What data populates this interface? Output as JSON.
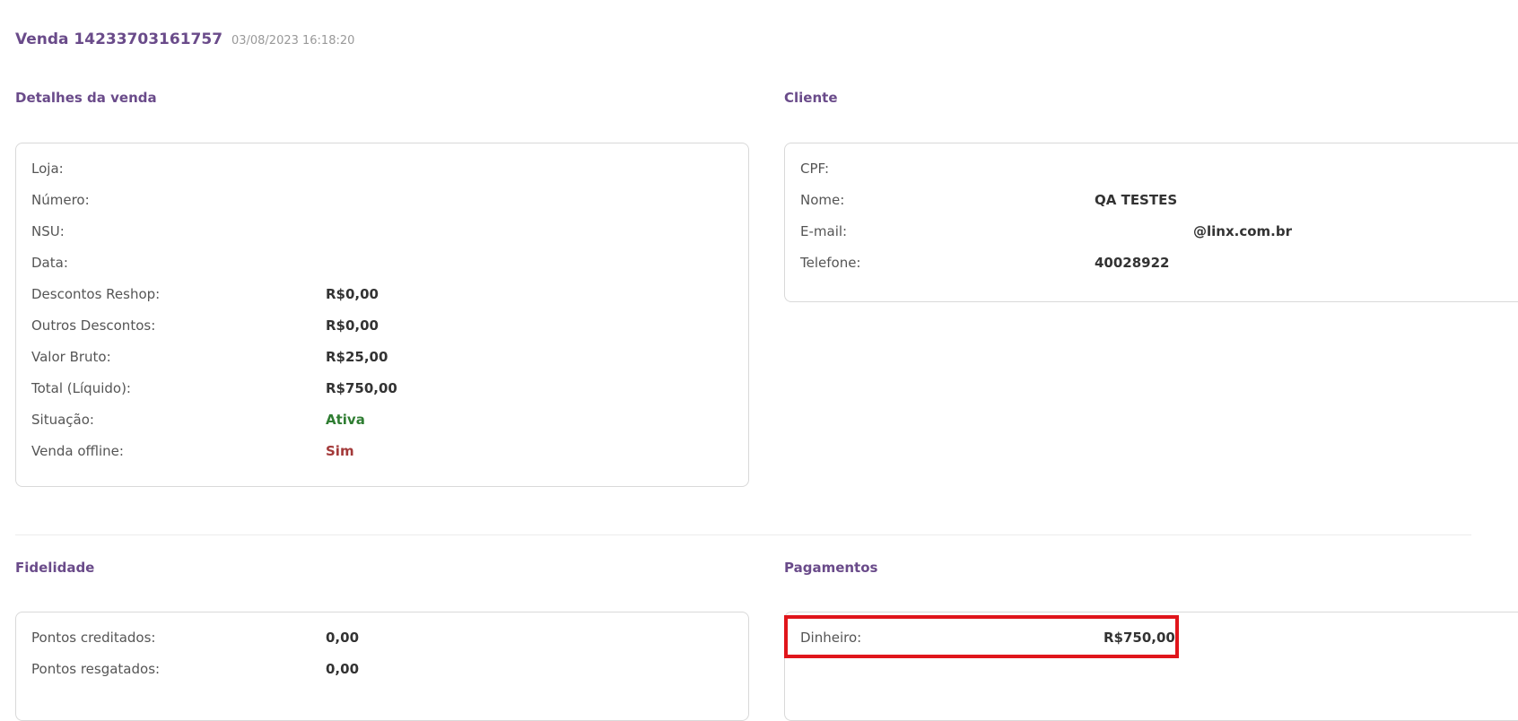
{
  "header": {
    "title": "Venda 14233703161757",
    "datetime": "03/08/2023 16:18:20"
  },
  "sections": {
    "sale_details_title": "Detalhes da venda",
    "client_title": "Cliente",
    "loyalty_title": "Fidelidade",
    "payments_title": "Pagamentos"
  },
  "sale_details": {
    "store_label": "Loja:",
    "number_label": "Número:",
    "nsu_label": "NSU:",
    "date_label": "Data:",
    "reshop_discounts_label": "Descontos Reshop:",
    "reshop_discounts_value": "R$0,00",
    "other_discounts_label": "Outros Descontos:",
    "other_discounts_value": "R$0,00",
    "gross_value_label": "Valor Bruto:",
    "gross_value_value": "R$25,00",
    "net_total_label": "Total (Líquido):",
    "net_total_value": "R$750,00",
    "status_label": "Situação:",
    "status_value": "Ativa",
    "offline_label": "Venda offline:",
    "offline_value": "Sim"
  },
  "client": {
    "cpf_label": "CPF:",
    "name_label": "Nome:",
    "name_value": "QA TESTES",
    "email_label": "E-mail:",
    "email_value": "@linx.com.br",
    "phone_label": "Telefone:",
    "phone_value": "40028922"
  },
  "loyalty": {
    "credited_label": "Pontos creditados:",
    "credited_value": "0,00",
    "redeemed_label": "Pontos resgatados:",
    "redeemed_value": "0,00"
  },
  "payments": {
    "cash_label": "Dinheiro:",
    "cash_value": "R$750,00"
  },
  "colors": {
    "accent": "#6a4b8a",
    "active": "#2f7d32",
    "offline": "#a33a3a",
    "highlight": "#e0151b"
  }
}
